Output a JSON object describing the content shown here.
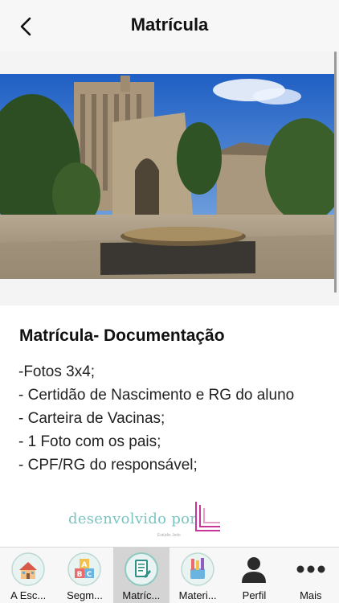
{
  "header": {
    "title": "Matrícula"
  },
  "content": {
    "title": "Matrícula- Documentação",
    "items": [
      "-Fotos 3x4;",
      "- Certidão de Nascimento e RG do aluno",
      "- Carteira de Vacinas;",
      "- 1 Foto com os pais;",
      "- CPF/RG do responsável;"
    ]
  },
  "footer_brand": {
    "text": "desenvolvido por",
    "subtext": "Estúdio Jeito"
  },
  "tabs": [
    {
      "label": "A Esc...",
      "icon": "school-icon"
    },
    {
      "label": "Segm...",
      "icon": "abc-blocks-icon"
    },
    {
      "label": "Matríc...",
      "icon": "document-icon",
      "active": true
    },
    {
      "label": "Materi...",
      "icon": "pencils-icon"
    },
    {
      "label": "Perfil",
      "icon": "user-icon"
    },
    {
      "label": "Mais",
      "icon": "more-dots-icon"
    }
  ]
}
